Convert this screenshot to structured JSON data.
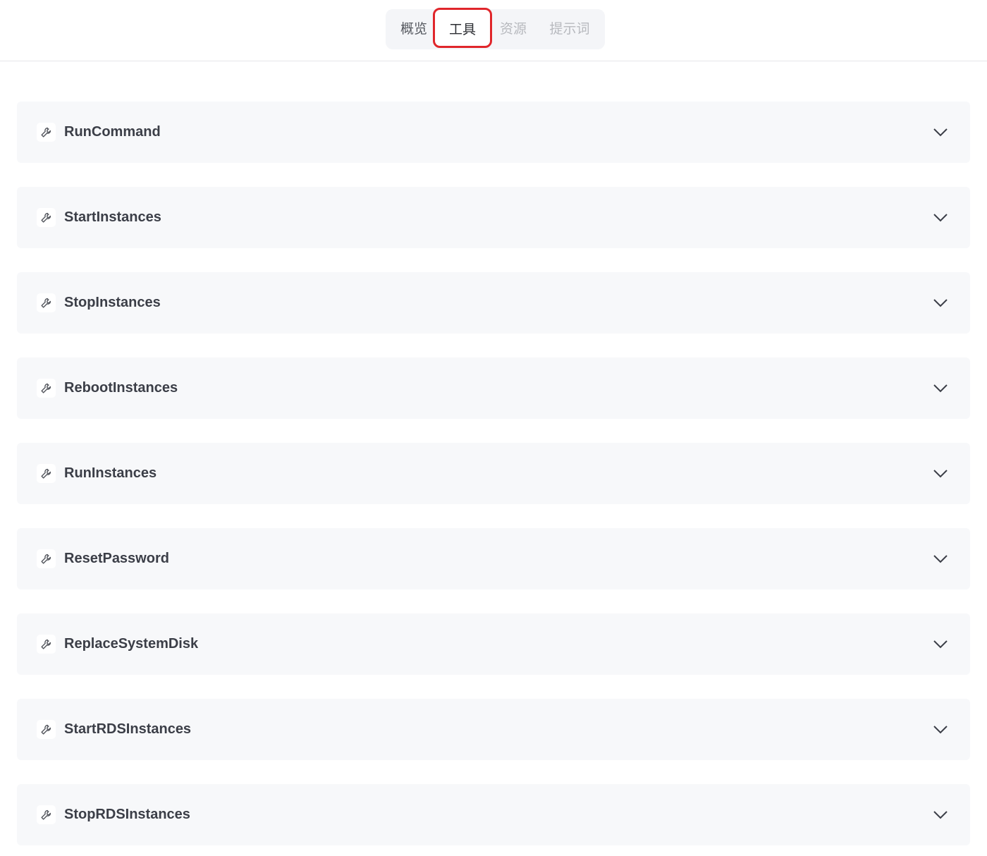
{
  "tabs": {
    "overview": "概览",
    "tools": "工具",
    "resources": "资源",
    "prompts": "提示词",
    "active": "tools"
  },
  "tools": [
    {
      "name": "RunCommand",
      "icon": "wrench-icon"
    },
    {
      "name": "StartInstances",
      "icon": "wrench-icon"
    },
    {
      "name": "StopInstances",
      "icon": "wrench-icon"
    },
    {
      "name": "RebootInstances",
      "icon": "wrench-icon"
    },
    {
      "name": "RunInstances",
      "icon": "wrench-icon"
    },
    {
      "name": "ResetPassword",
      "icon": "wrench-icon"
    },
    {
      "name": "ReplaceSystemDisk",
      "icon": "wrench-icon"
    },
    {
      "name": "StartRDSInstances",
      "icon": "wrench-icon"
    },
    {
      "name": "StopRDSInstances",
      "icon": "wrench-icon"
    }
  ],
  "colors": {
    "highlight": "#e0262b",
    "item_background": "#f7f8fa",
    "text": "#3b3e47"
  }
}
